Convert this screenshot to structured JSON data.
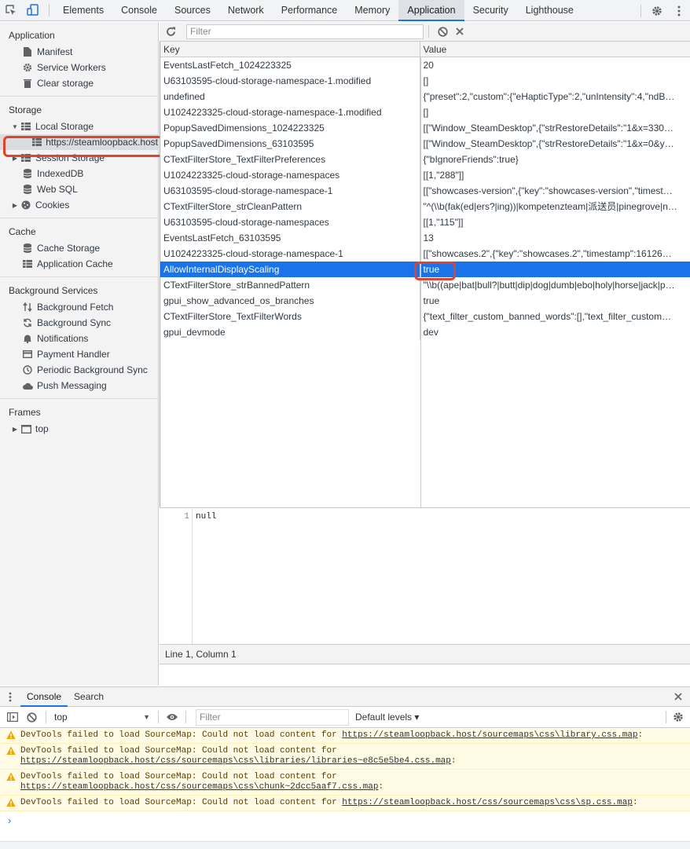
{
  "toolbar": {
    "tabs": [
      "Elements",
      "Console",
      "Sources",
      "Network",
      "Performance",
      "Memory",
      "Application",
      "Security",
      "Lighthouse"
    ],
    "active_tab": "Application"
  },
  "sidebar": {
    "application_header": "Application",
    "application_items": [
      "Manifest",
      "Service Workers",
      "Clear storage"
    ],
    "storage_header": "Storage",
    "local_storage": "Local Storage",
    "local_storage_child": "https://steamloopback.host",
    "storage_items": [
      "Session Storage",
      "IndexedDB",
      "Web SQL",
      "Cookies"
    ],
    "cache_header": "Cache",
    "cache_items": [
      "Cache Storage",
      "Application Cache"
    ],
    "bg_header": "Background Services",
    "bg_items": [
      "Background Fetch",
      "Background Sync",
      "Notifications",
      "Payment Handler",
      "Periodic Background Sync",
      "Push Messaging"
    ],
    "frames_header": "Frames",
    "frames_top": "top"
  },
  "main": {
    "filter_placeholder": "Filter",
    "col_key": "Key",
    "col_value": "Value",
    "rows": [
      {
        "key": "EventsLastFetch_1024223325",
        "value": "20"
      },
      {
        "key": "U63103595-cloud-storage-namespace-1.modified",
        "value": "[]"
      },
      {
        "key": "undefined",
        "value": "{\"preset\":2,\"custom\":{\"eHapticType\":2,\"unIntensity\":4,\"ndB…"
      },
      {
        "key": "U1024223325-cloud-storage-namespace-1.modified",
        "value": "[]"
      },
      {
        "key": "PopupSavedDimensions_1024223325",
        "value": "[[\"Window_SteamDesktop\",{\"strRestoreDetails\":\"1&x=330…"
      },
      {
        "key": "PopupSavedDimensions_63103595",
        "value": "[[\"Window_SteamDesktop\",{\"strRestoreDetails\":\"1&x=0&y…"
      },
      {
        "key": "CTextFilterStore_TextFilterPreferences",
        "value": "{\"bIgnoreFriends\":true}"
      },
      {
        "key": "U1024223325-cloud-storage-namespaces",
        "value": "[[1,\"288\"]]"
      },
      {
        "key": "U63103595-cloud-storage-namespace-1",
        "value": "[[\"showcases-version\",{\"key\":\"showcases-version\",\"timest…"
      },
      {
        "key": "CTextFilterStore_strCleanPattern",
        "value": "\"^(\\\\b(fak(ed|ers?|ing))|kompetenzteam|派送员|pinegrove|n…"
      },
      {
        "key": "U63103595-cloud-storage-namespaces",
        "value": "[[1,\"115\"]]"
      },
      {
        "key": "EventsLastFetch_63103595",
        "value": "13"
      },
      {
        "key": "U1024223325-cloud-storage-namespace-1",
        "value": "[[\"showcases.2\",{\"key\":\"showcases.2\",\"timestamp\":16126…"
      },
      {
        "key": "AllowInternalDisplayScaling",
        "value": "true"
      },
      {
        "key": "CTextFilterStore_strBannedPattern",
        "value": "\"\\\\b((ape|bat|bull?|butt|dip|dog|dumb|ebo|holy|horse|jack|p…"
      },
      {
        "key": "gpui_show_advanced_os_branches",
        "value": "true"
      },
      {
        "key": "CTextFilterStore_TextFilterWords",
        "value": "{\"text_filter_custom_banned_words\":[],\"text_filter_custom…"
      },
      {
        "key": "gpui_devmode",
        "value": "dev"
      }
    ],
    "selected_index": 13,
    "editor_line": "1",
    "editor_code": "null",
    "status": "Line 1, Column 1"
  },
  "drawer": {
    "tab_console": "Console",
    "tab_search": "Search",
    "context": "top",
    "filter_placeholder": "Filter",
    "levels": "Default levels ▾",
    "warnings": [
      {
        "text": "DevTools failed to load SourceMap: Could not load content for ",
        "link": "https://steamloopback.host/sourcemaps\\css\\library.css.map",
        "tail": ":"
      },
      {
        "text": "DevTools failed to load SourceMap: Could not load content for ",
        "link": "https://steamloopback.host/css/sourcemaps\\css\\libraries/libraries~e8c5e5be4.css.map",
        "tail": ":"
      },
      {
        "text": "DevTools failed to load SourceMap: Could not load content for ",
        "link": "https://steamloopback.host/css/sourcemaps\\css\\chunk~2dcc5aaf7.css.map",
        "tail": ":"
      },
      {
        "text": "DevTools failed to load SourceMap: Could not load content for ",
        "link": "https://steamloopback.host/css/sourcemaps\\css\\sp.css.map",
        "tail": ":"
      }
    ],
    "prompt": "›"
  },
  "colors": {
    "accent": "#1a73e8",
    "highlight_box": "#e0432b",
    "warning_bg": "#fffbe5"
  }
}
